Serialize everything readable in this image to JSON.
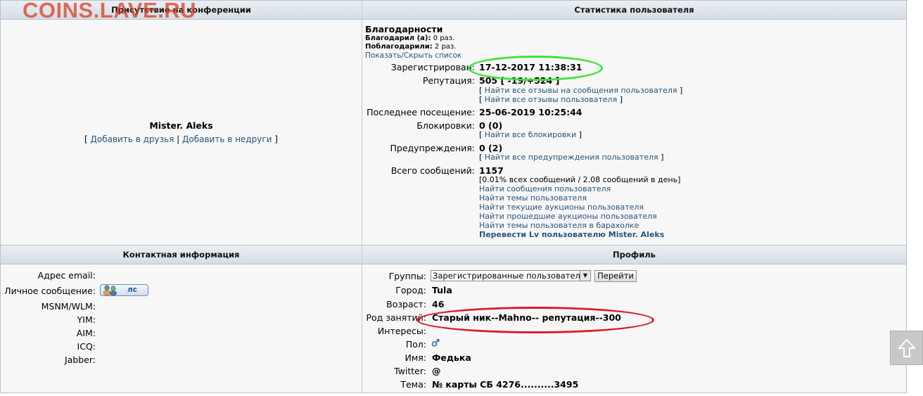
{
  "watermark": "COINS.LAVE.RU",
  "presence": {
    "header": "Присутствие на конференции",
    "username": "Mister. Aleks",
    "bracket_open": "[",
    "add_friend": "Добавить в друзья",
    "sep": "|",
    "add_foe": "Добавить в недруги",
    "bracket_close": "]"
  },
  "stats": {
    "header": "Статистика пользователя",
    "thanks_title": "Благодарности",
    "thanked_label": "Благодарил (а):",
    "thanked_value": "0 раз.",
    "was_thanked_label": "Поблагодарили:",
    "was_thanked_value": "2 раз.",
    "toggle_list": "Показать/Скрыть список",
    "registered_label": "Зарегистрирован:",
    "registered_value": "17-12-2017 11:38:31",
    "reputation_label": "Репутация:",
    "reputation_value": "505 [ -19/+524 ]",
    "rep_link1": "Найти все отзывы на сообщения пользователя",
    "rep_link2": "Найти все отзывы пользователя",
    "last_visit_label": "Последнее посещение:",
    "last_visit_value": "25-06-2019 10:25:44",
    "blocks_label": "Блокировки:",
    "blocks_value": "0 (0)",
    "blocks_link": "Найти все блокировки",
    "warnings_label": "Предупреждения:",
    "warnings_value": "0 (2)",
    "warnings_link": "Найти все предупреждения пользователя",
    "posts_label": "Всего сообщений:",
    "posts_value": "1157",
    "posts_stats": "[0.01% всех сообщений / 2.08 сообщений в день]",
    "links": [
      "Найти сообщения пользователя",
      "Найти темы пользователя",
      "Найти текущие аукционы пользователя",
      "Найти прошедшие аукционы пользователя",
      "Найти темы пользователя в барахолке"
    ],
    "transfer_link": "Перевести Lv пользователю Mister. Aleks"
  },
  "contact": {
    "header": "Контактная информация",
    "email_label": "Адрес email:",
    "pm_label": "Личное сообщение:",
    "pm_button": "лс",
    "msn_label": "MSNM/WLM:",
    "yim_label": "YIM:",
    "aim_label": "AIM:",
    "icq_label": "ICQ:",
    "jabber_label": "Jabber:"
  },
  "profile": {
    "header": "Профиль",
    "groups_label": "Группы:",
    "groups_value": "Зарегистрированные пользователи",
    "go_button": "Перейти",
    "city_label": "Город:",
    "city_value": "Tula",
    "age_label": "Возраст:",
    "age_value": "46",
    "occupation_label": "Род занятий:",
    "occupation_value": "Старый ник--Mahno-- репутация--300",
    "interests_label": "Интересы:",
    "gender_label": "Пол:",
    "gender_icon": "male-icon",
    "name_label": "Имя:",
    "name_value": "Федька",
    "twitter_label": "Twitter:",
    "twitter_value": "@",
    "topic_label": "Тема:",
    "topic_value": "№ карты СБ 4276..........3495"
  },
  "colors": {
    "link": "#27557e",
    "green_oval": "#3ee23a",
    "red_oval": "#e01a2a",
    "watermark": "#d93a1c"
  }
}
